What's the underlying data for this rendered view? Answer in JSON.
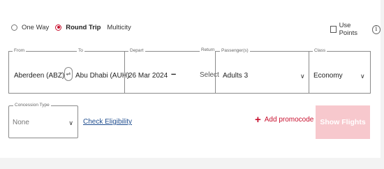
{
  "trip_types": {
    "one_way": "One Way",
    "round_trip": "Round Trip",
    "multicity": "Multicity",
    "selected": "Round Trip"
  },
  "use_points": "Use Points",
  "from": {
    "legend": "From",
    "value": "Aberdeen (ABZ)"
  },
  "to": {
    "legend": "To",
    "value": "Abu Dhabi (AUH)"
  },
  "depart": {
    "legend": "Depart",
    "value": "26 Mar 2024"
  },
  "return": {
    "legend": "Return",
    "value": "Select"
  },
  "passengers": {
    "legend": "Passenger(s)",
    "value": "Adults 3"
  },
  "class": {
    "legend": "Class",
    "value": "Economy"
  },
  "concession": {
    "legend": "Concession Type",
    "value": "None"
  },
  "check_eligibility": "Check Eligibility",
  "promo": {
    "plus": "+",
    "label": "Add promocode"
  },
  "info_glyph": "i",
  "show_flights": "Show Flights",
  "separator": "–",
  "icons": {
    "chevron": "chevron-down-icon",
    "swap": "swap-icon",
    "info": "info-icon",
    "plus": "plus-icon"
  },
  "colors": {
    "accent": "#c8102e",
    "button_disabled": "#f7c8cd",
    "link": "#1f4d8f"
  }
}
